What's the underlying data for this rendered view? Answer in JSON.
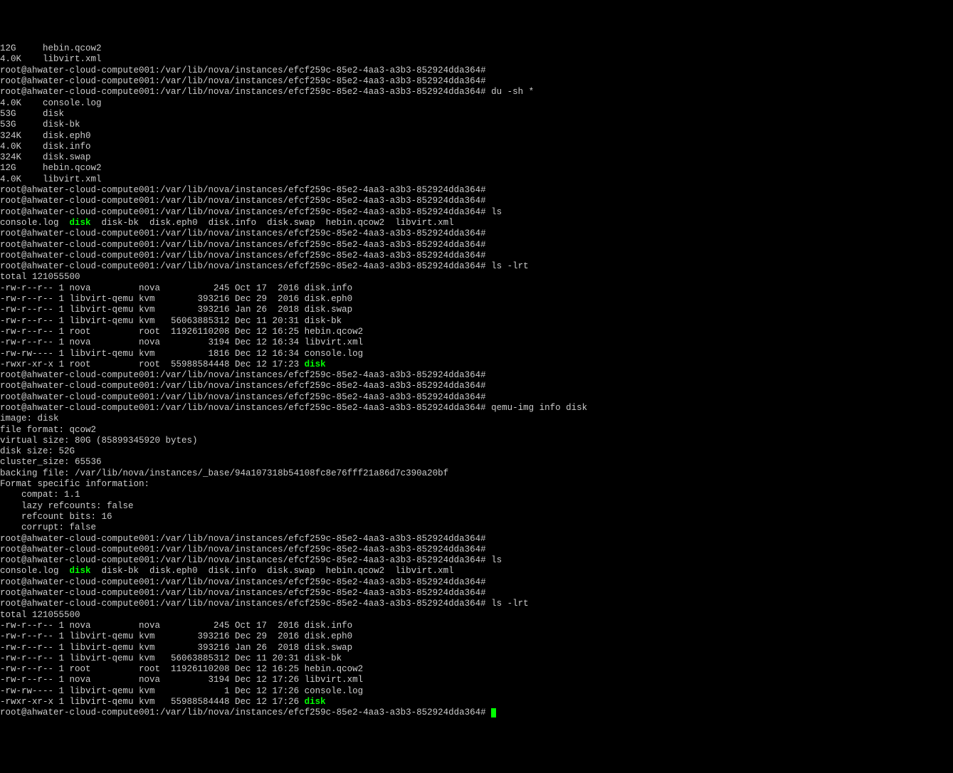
{
  "prompt": "root@ahwater-cloud-compute001:/var/lib/nova/instances/efcf259c-85e2-4aa3-a3b3-852924dda364#",
  "cmd_du": "du -sh *",
  "cmd_ls": "ls",
  "cmd_ls_lrt": "ls -lrt",
  "cmd_qemu": "qemu-img info disk",
  "du_top": [
    "12G     hebin.qcow2",
    "4.0K    libvirt.xml"
  ],
  "du_out": [
    "4.0K    console.log",
    "53G     disk",
    "53G     disk-bk",
    "324K    disk.eph0",
    "4.0K    disk.info",
    "324K    disk.swap",
    "12G     hebin.qcow2",
    "4.0K    libvirt.xml"
  ],
  "ls_out": {
    "pre": "console.log  ",
    "disk": "disk",
    "post": "  disk-bk  disk.eph0  disk.info  disk.swap  hebin.qcow2  libvirt.xml"
  },
  "total": "total 121055500",
  "lrt1": [
    "-rw-r--r-- 1 nova         nova          245 Oct 17  2016 disk.info",
    "-rw-r--r-- 1 libvirt-qemu kvm        393216 Dec 29  2016 disk.eph0",
    "-rw-r--r-- 1 libvirt-qemu kvm        393216 Jan 26  2018 disk.swap",
    "-rw-r--r-- 1 libvirt-qemu kvm   56063885312 Dec 11 20:31 disk-bk",
    "-rw-r--r-- 1 root         root  11926110208 Dec 12 16:25 hebin.qcow2",
    "-rw-r--r-- 1 nova         nova         3194 Dec 12 16:34 libvirt.xml",
    "-rw-rw---- 1 libvirt-qemu kvm          1816 Dec 12 16:34 console.log"
  ],
  "lrt1_disk_pre": "-rwxr-xr-x 1 root         root  55988584448 Dec 12 17:23 ",
  "qemu_out": [
    "image: disk",
    "file format: qcow2",
    "virtual size: 80G (85899345920 bytes)",
    "disk size: 52G",
    "cluster_size: 65536",
    "backing file: /var/lib/nova/instances/_base/94a107318b54108fc8e76fff21a86d7c390a20bf",
    "Format specific information:",
    "    compat: 1.1",
    "    lazy refcounts: false",
    "    refcount bits: 16",
    "    corrupt: false"
  ],
  "lrt2": [
    "-rw-r--r-- 1 nova         nova          245 Oct 17  2016 disk.info",
    "-rw-r--r-- 1 libvirt-qemu kvm        393216 Dec 29  2016 disk.eph0",
    "-rw-r--r-- 1 libvirt-qemu kvm        393216 Jan 26  2018 disk.swap",
    "-rw-r--r-- 1 libvirt-qemu kvm   56063885312 Dec 11 20:31 disk-bk",
    "-rw-r--r-- 1 root         root  11926110208 Dec 12 16:25 hebin.qcow2",
    "-rw-r--r-- 1 nova         nova         3194 Dec 12 17:26 libvirt.xml",
    "-rw-rw---- 1 libvirt-qemu kvm             1 Dec 12 17:26 console.log"
  ],
  "lrt2_disk_pre": "-rwxr-xr-x 1 libvirt-qemu kvm   55988584448 Dec 12 17:26 ",
  "disk_word": "disk",
  "space": " "
}
